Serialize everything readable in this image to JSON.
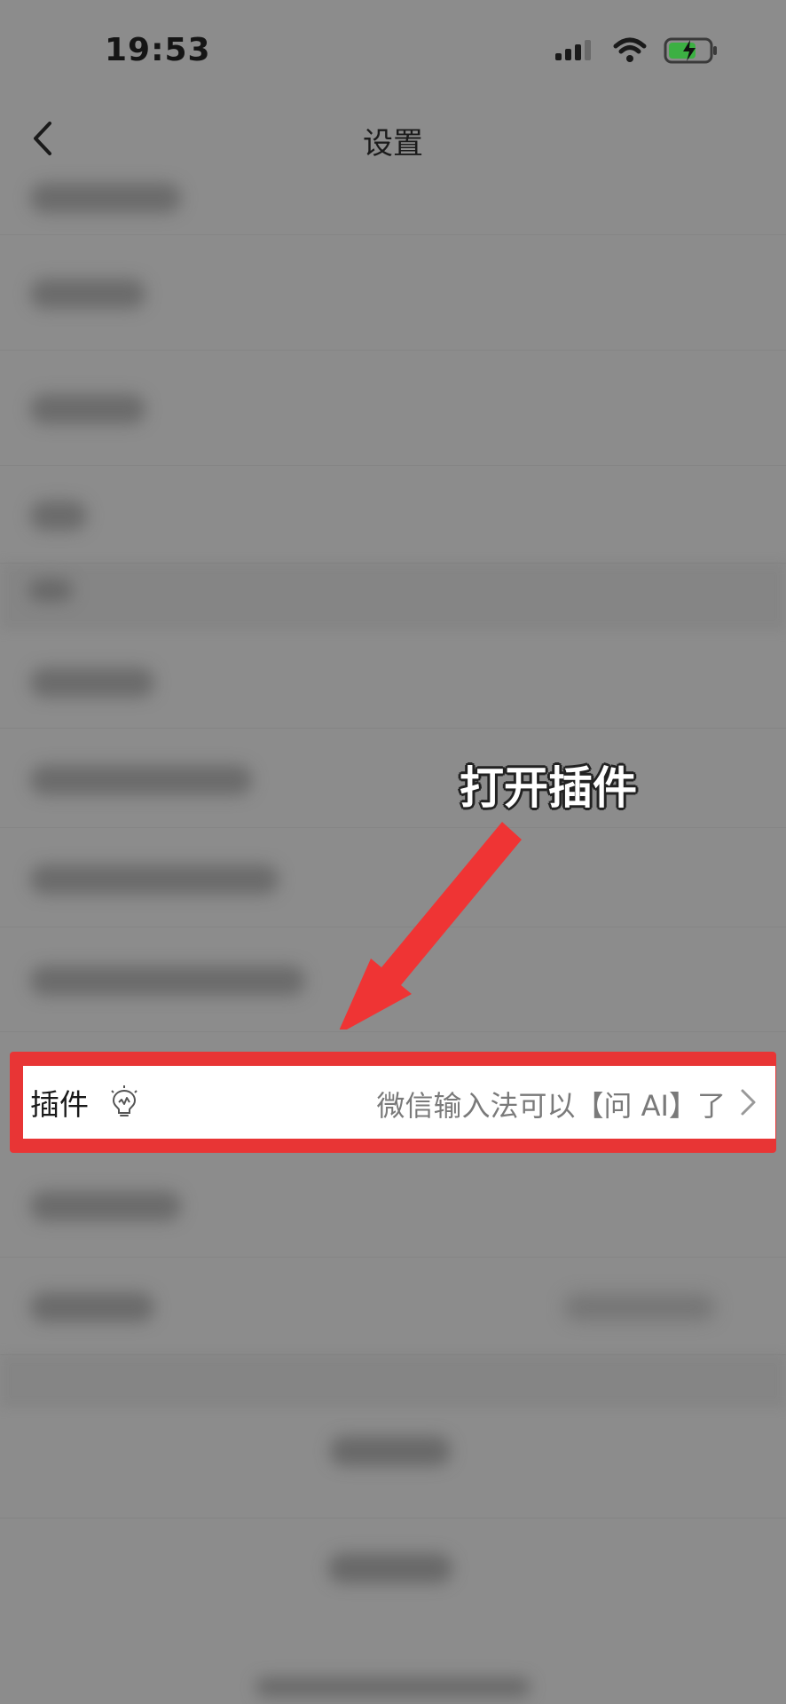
{
  "status_bar": {
    "time": "19:53",
    "icons": [
      "signal-icon",
      "wifi-icon",
      "battery-charging-icon"
    ],
    "battery_color": "#3cb043"
  },
  "nav": {
    "title": "设置",
    "back_icon": "chevron-left-icon"
  },
  "highlighted_row": {
    "label": "插件",
    "icon": "lightbulb-icon",
    "subtitle": "微信输入法可以【问 AI】了",
    "chevron_icon": "chevron-right-icon",
    "highlight_color": "#e83535"
  },
  "annotation": {
    "text": "打开插件",
    "arrow_color": "#ef3434"
  }
}
